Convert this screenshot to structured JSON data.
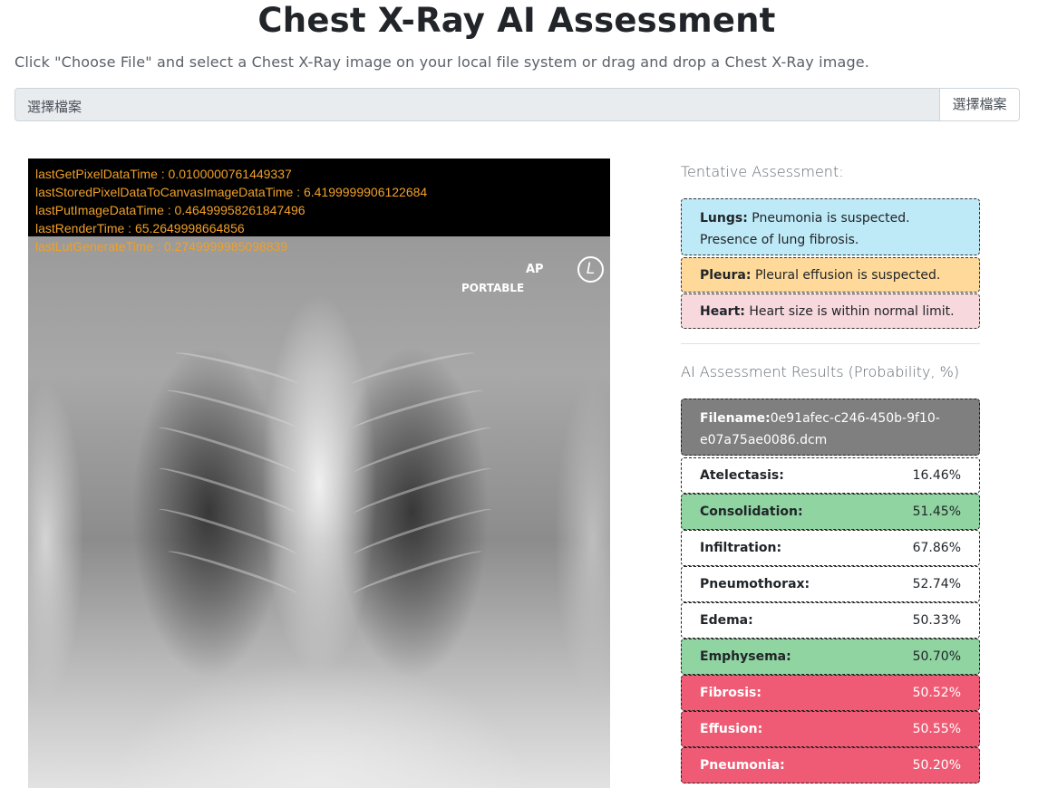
{
  "header": {
    "title": "Chest X-Ray AI Assessment",
    "instructions": "Click \"Choose File\" and select a Chest X-Ray image on your local file system or drag and drop a Chest X-Ray image."
  },
  "file_input": {
    "placeholder": "選擇檔案",
    "button_label": "選擇檔案"
  },
  "viewer": {
    "overlay": [
      "lastGetPixelDataTime : 0.0100000761449337",
      "lastStoredPixelDataToCanvasImageDataTime : 6.4199999906122684",
      "lastPutImageDataTime : 0.46499958261847496",
      "lastRenderTime : 65.2649998664856",
      "lastLutGenerateTime : 0.2749999985098839"
    ],
    "marker_ap": "AP",
    "marker_portable": "PORTABLE",
    "marker_side": "L"
  },
  "tentative": {
    "heading": "Tentative Assessment:",
    "lungs": {
      "label": "Lungs:",
      "text": "Pneumonia is suspected.",
      "text2": "Presence of lung fibrosis.",
      "color": "#bee9f6"
    },
    "pleura": {
      "label": "Pleura:",
      "text": "Pleural effusion is suspected.",
      "color": "#ffd999"
    },
    "heart": {
      "label": "Heart:",
      "text": "Heart size is within normal limit.",
      "color": "#f6d8dd"
    }
  },
  "results": {
    "heading": "AI Assessment Results (Probability, %)",
    "filename_label": "Filename:",
    "filename": "0e91afec-c246-450b-9f10-e07a75ae0086.dcm",
    "rows": [
      {
        "label": "Atelectasis:",
        "value": "16.46%",
        "color": "#ffffff",
        "text_color": "#212529"
      },
      {
        "label": "Consolidation:",
        "value": "51.45%",
        "color": "#8fd4a1",
        "text_color": "#212529"
      },
      {
        "label": "Infiltration:",
        "value": "67.86%",
        "color": "#ffffff",
        "text_color": "#212529"
      },
      {
        "label": "Pneumothorax:",
        "value": "52.74%",
        "color": "#ffffff",
        "text_color": "#212529"
      },
      {
        "label": "Edema:",
        "value": "50.33%",
        "color": "#ffffff",
        "text_color": "#212529"
      },
      {
        "label": "Emphysema:",
        "value": "50.70%",
        "color": "#8fd4a1",
        "text_color": "#212529"
      },
      {
        "label": "Fibrosis:",
        "value": "50.52%",
        "color": "#ef5b75",
        "text_color": "#ffffff"
      },
      {
        "label": "Effusion:",
        "value": "50.55%",
        "color": "#ef5b75",
        "text_color": "#ffffff"
      },
      {
        "label": "Pneumonia:",
        "value": "50.20%",
        "color": "#ef5b75",
        "text_color": "#ffffff"
      }
    ]
  }
}
